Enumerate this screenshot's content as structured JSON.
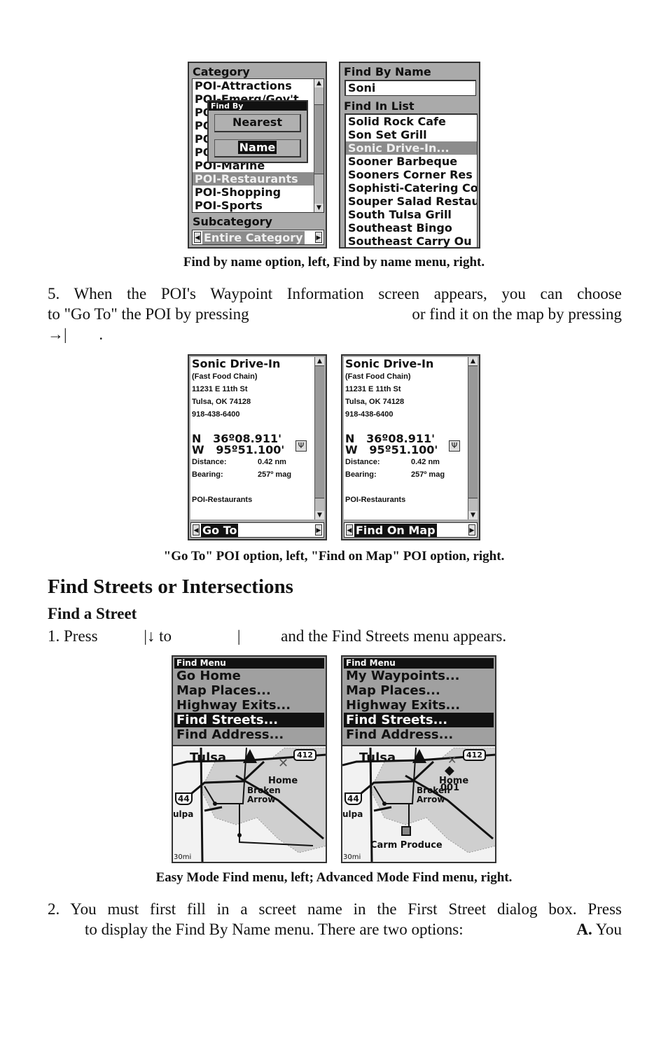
{
  "figure1": {
    "left_screen": {
      "category_label": "Category",
      "category_items": [
        "POI-Attractions",
        "POI-Emerg/Gov't",
        "POI-",
        "POI-",
        "POI-",
        "POI-",
        "POI-Marine",
        "POI-Restaurants",
        "POI-Shopping",
        "POI-Sports"
      ],
      "selected_category": "POI-Restaurants",
      "dialog_title": "Find By",
      "dialog_options": [
        "Nearest",
        "Name"
      ],
      "selected_option": "Name",
      "subcategory_label": "Subcategory",
      "subcategory_value": "Entire Category"
    },
    "right_screen": {
      "find_by_name_label": "Find By Name",
      "name_input_value": "Soni",
      "find_in_list_label": "Find In List",
      "results": [
        "Solid Rock Cafe",
        "Son Set Grill",
        "Sonic Drive-In...",
        "Sooner Barbeque",
        "Sooners Corner Res",
        "Sophisti-Catering Co",
        "Souper Salad Restau",
        "South Tulsa Grill",
        "Southeast Bingo",
        "Southeast Carry Ou"
      ],
      "selected_result": "Sonic Drive-In..."
    },
    "caption": "Find by name option, left, Find by name menu, right."
  },
  "step5": {
    "line1": "5. When the POI's Waypoint Information screen appears, you can choose",
    "line2_a": "to \"Go To\" the POI by pressing",
    "line2_b": "or find it on the map by pressing",
    "line3": "→|",
    "line3_end": "."
  },
  "figure2": {
    "poi": {
      "name": "Sonic Drive-In",
      "type": "(Fast Food Chain)",
      "street": "11231 E 11th St",
      "city": "Tulsa, OK 74128",
      "phone": "918-438-6400",
      "lat_prefix": "N",
      "lat": "36º08.911'",
      "lon_prefix": "W",
      "lon": "95º51.100'",
      "distance_label": "Distance:",
      "distance_value": "0.42 nm",
      "bearing_label": "Bearing:",
      "bearing_value": "257º mag",
      "category": "POI-Restaurants"
    },
    "left_option": "Go To",
    "right_option": "Find On Map",
    "caption": "\"Go To\" POI option, left, \"Find on Map\" POI option, right."
  },
  "section": {
    "heading": "Find Streets or Intersections",
    "subheading": "Find a Street",
    "step1_a": "1. Press",
    "step1_b": "|↓ to",
    "step1_c": "|",
    "step1_d": "and the Find Streets menu appears."
  },
  "figure3": {
    "left_menu": {
      "title": "Find Menu",
      "items": [
        "Go Home",
        "Map Places...",
        "Highway Exits...",
        "Find Streets...",
        "Find Address..."
      ],
      "selected": "Find Streets..."
    },
    "right_menu": {
      "title": "Find Menu",
      "items": [
        "My Waypoints...",
        "Map Places...",
        "Highway Exits...",
        "Find Streets...",
        "Find Address..."
      ],
      "selected": "Find Streets..."
    },
    "map_labels": {
      "city": "Tulsa",
      "highway_412": "412",
      "interstate_44": "44",
      "home": "Home",
      "broken_arrow_1": "Broken",
      "broken_arrow_2": "Arrow",
      "sapulpa": "ulpa",
      "scale": "30mi",
      "waypoint": "001",
      "produce": "Carm Produce"
    },
    "caption": "Easy Mode Find menu, left; Advanced Mode Find menu, right."
  },
  "step2": {
    "line1": "2. You must first fill in a screet name in the First Street dialog box. Press",
    "line2_a": "to display the Find By Name menu. There are two options:",
    "line2_b": "A.",
    "line2_c": "You"
  }
}
